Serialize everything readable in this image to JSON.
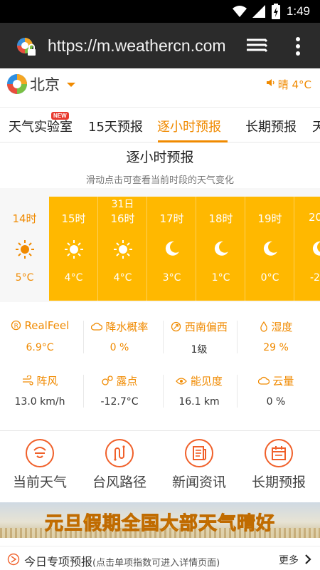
{
  "status_bar": {
    "time": "1:49"
  },
  "browser": {
    "url": "https://m.weathercn.com"
  },
  "header": {
    "city": "北京",
    "current_weather": "晴 4°C"
  },
  "nav": {
    "tabs": [
      "天气实验室",
      "15天预报",
      "逐小时预报",
      "长期预报",
      "天"
    ],
    "active_tab": "逐小时预报",
    "new_badge": "NEW"
  },
  "section": {
    "title": "逐小时预报",
    "subtitle": "滑动点击可查看当前时段的天气变化"
  },
  "hourly": [
    {
      "date": "",
      "hour": "14时",
      "icon": "sun-icon",
      "temp": "5°C"
    },
    {
      "date": "",
      "hour": "15时",
      "icon": "sun-icon",
      "temp": "4°C"
    },
    {
      "date": "31日",
      "hour": "16时",
      "icon": "sun-icon",
      "temp": "4°C"
    },
    {
      "date": "",
      "hour": "17时",
      "icon": "moon-icon",
      "temp": "3°C"
    },
    {
      "date": "",
      "hour": "18时",
      "icon": "moon-icon",
      "temp": "1°C"
    },
    {
      "date": "",
      "hour": "19时",
      "icon": "moon-icon",
      "temp": "0°C"
    },
    {
      "date": "",
      "hour": "20",
      "icon": "moon-icon",
      "temp": "-2"
    }
  ],
  "details": [
    {
      "label": "RealFeel",
      "value": "6.9°C",
      "icon": "realfeel-icon"
    },
    {
      "label": "降水概率",
      "value": "0 %",
      "icon": "cloud-icon"
    },
    {
      "label": "西南偏西",
      "value": "1级",
      "icon": "wind-direction-icon"
    },
    {
      "label": "湿度",
      "value": "29 %",
      "icon": "drop-icon"
    },
    {
      "label": "阵风",
      "value": "13.0 km/h",
      "icon": "gust-icon"
    },
    {
      "label": "露点",
      "value": "-12.7°C",
      "icon": "dewpoint-icon"
    },
    {
      "label": "能见度",
      "value": "16.1 km",
      "icon": "eye-icon"
    },
    {
      "label": "云量",
      "value": "0 %",
      "icon": "cloud-icon"
    }
  ],
  "quick_links": [
    {
      "label": "当前天气",
      "icon": "current-weather-icon"
    },
    {
      "label": "台风路径",
      "icon": "typhoon-path-icon"
    },
    {
      "label": "新闻资讯",
      "icon": "news-icon"
    },
    {
      "label": "长期预报",
      "icon": "calendar-icon"
    }
  ],
  "banner": {
    "text": "元旦假期全国大部天气晴好"
  },
  "special": {
    "title": "今日专项预报",
    "hint": "(点击单项指数可进入详情页面)",
    "more": "更多"
  },
  "colors": {
    "accent": "#f08a00",
    "hour_bg": "#ffb800",
    "icon_red": "#f0602a"
  }
}
